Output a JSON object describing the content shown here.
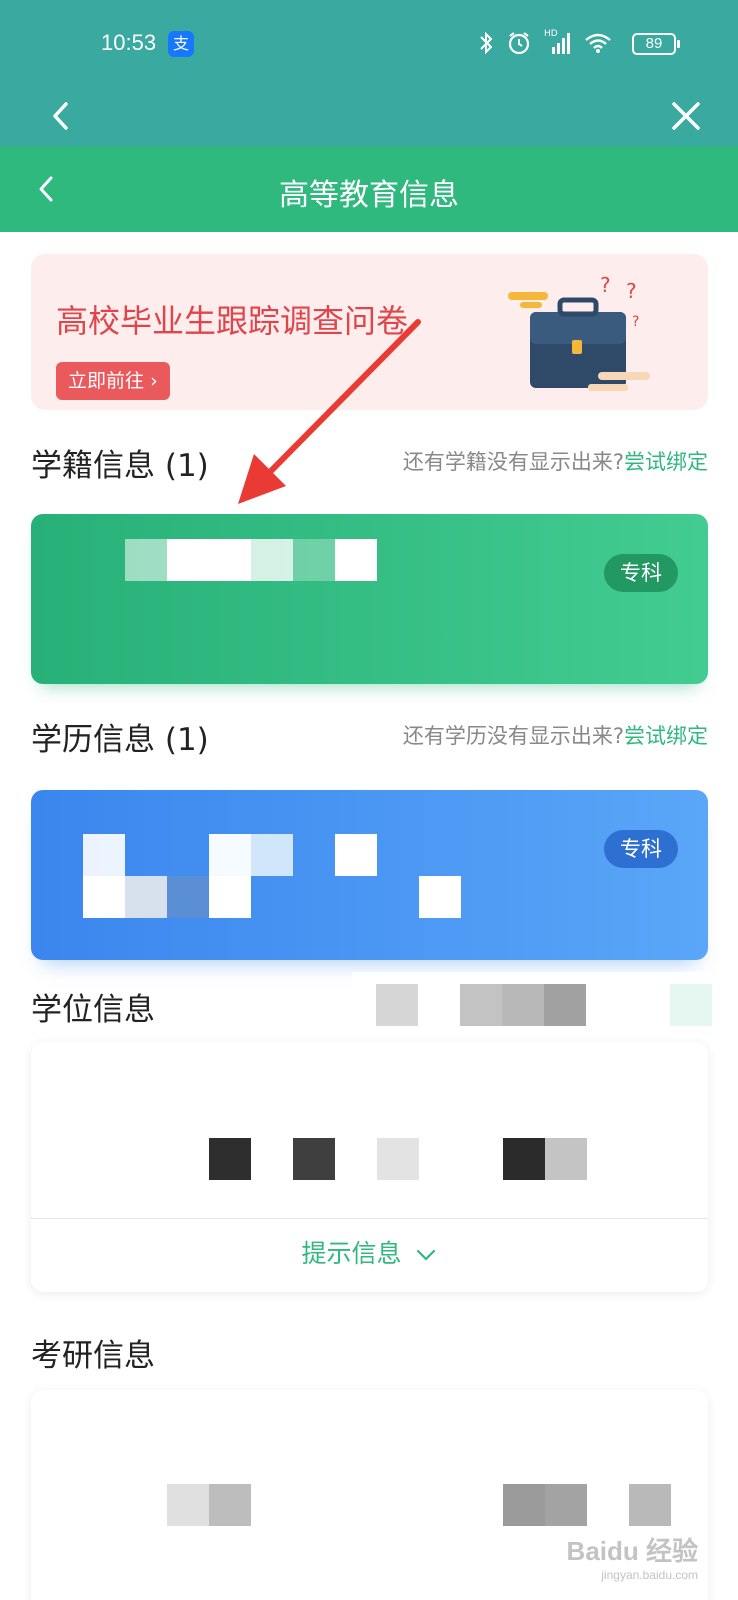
{
  "status_bar": {
    "time": "10:53",
    "alipay_icon_label": "支",
    "network_label": "HD",
    "battery": "89"
  },
  "page_title": "高等教育信息",
  "banner": {
    "title": "高校毕业生跟踪调查问卷",
    "button": "立即前往"
  },
  "sections": {
    "xueji": {
      "title": "学籍信息 (1)",
      "hint": "还有学籍没有显示出来?",
      "link": "尝试绑定",
      "badge": "专科"
    },
    "xueli": {
      "title": "学历信息 (1)",
      "hint": "还有学历没有显示出来?",
      "link": "尝试绑定",
      "badge": "专科"
    },
    "xuewei": {
      "title": "学位信息",
      "tip": "提示信息"
    },
    "kaoyan": {
      "title": "考研信息"
    }
  },
  "watermark": {
    "brand": "Baidu 经验",
    "url": "jingyan.baidu.com"
  },
  "colors": {
    "teal": "#3aaaa0",
    "green": "#2fb97f",
    "blue": "#3a86ee",
    "red": "#e0454b"
  }
}
